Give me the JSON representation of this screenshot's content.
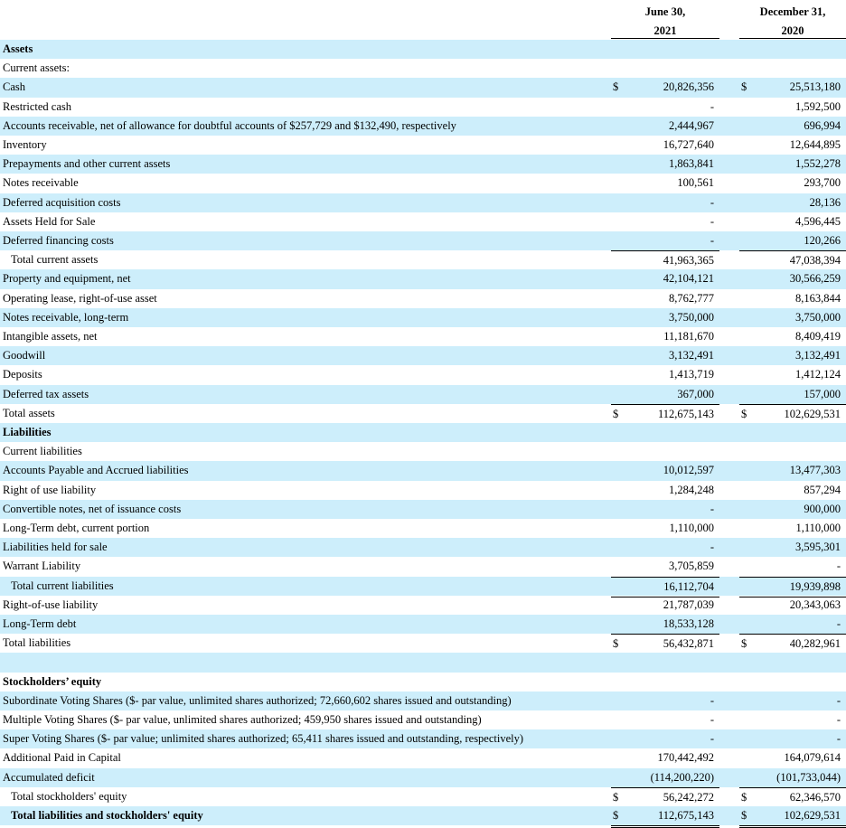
{
  "header": {
    "col1_line1": "June 30,",
    "col1_line2": "2021",
    "col2_line1": "December 31,",
    "col2_line2": "2020"
  },
  "rows": [
    {
      "label": "Assets",
      "bold": true
    },
    {
      "label": "Current assets:"
    },
    {
      "label": "Cash",
      "cur1": "$",
      "v1": "20,826,356",
      "cur2": "$",
      "v2": "25,513,180"
    },
    {
      "label": "Restricted cash",
      "v1": "-",
      "v2": "1,592,500"
    },
    {
      "label": "Accounts receivable, net of allowance for doubtful accounts of $257,729 and $132,490, respectively",
      "v1": "2,444,967",
      "v2": "696,994"
    },
    {
      "label": "Inventory",
      "v1": "16,727,640",
      "v2": "12,644,895"
    },
    {
      "label": "Prepayments and other current assets",
      "v1": "1,863,841",
      "v2": "1,552,278"
    },
    {
      "label": "Notes receivable",
      "v1": "100,561",
      "v2": "293,700"
    },
    {
      "label": "Deferred acquisition costs",
      "v1": "-",
      "v2": "28,136"
    },
    {
      "label": "Assets Held for Sale",
      "v1": "-",
      "v2": "4,596,445"
    },
    {
      "label": "Deferred financing costs",
      "v1": "-",
      "v2": "120,266"
    },
    {
      "label": "Total current assets",
      "indent": true,
      "v1": "41,963,365",
      "v2": "47,038,394",
      "rule": "top-bottom"
    },
    {
      "label": "Property and equipment, net",
      "v1": "42,104,121",
      "v2": "30,566,259"
    },
    {
      "label": "Operating lease, right-of-use asset",
      "v1": "8,762,777",
      "v2": "8,163,844"
    },
    {
      "label": "Notes receivable, long-term",
      "v1": "3,750,000",
      "v2": "3,750,000"
    },
    {
      "label": "Intangible assets, net",
      "v1": "11,181,670",
      "v2": "8,409,419"
    },
    {
      "label": "Goodwill",
      "v1": "3,132,491",
      "v2": "3,132,491"
    },
    {
      "label": "Deposits",
      "v1": "1,413,719",
      "v2": "1,412,124"
    },
    {
      "label": "Deferred tax assets",
      "v1": "367,000",
      "v2": "157,000"
    },
    {
      "label": "Total assets",
      "cur1": "$",
      "v1": "112,675,143",
      "cur2": "$",
      "v2": "102,629,531",
      "rule": "top-double"
    },
    {
      "label": "Liabilities",
      "bold": true
    },
    {
      "label": "Current liabilities"
    },
    {
      "label": "Accounts Payable and Accrued liabilities",
      "v1": "10,012,597",
      "v2": "13,477,303"
    },
    {
      "label": "Right of use liability",
      "v1": "1,284,248",
      "v2": "857,294"
    },
    {
      "label": "Convertible notes, net of issuance costs",
      "v1": "-",
      "v2": "900,000"
    },
    {
      "label": "Long-Term debt, current portion",
      "v1": "1,110,000",
      "v2": "1,110,000"
    },
    {
      "label": "Liabilities held for sale",
      "v1": "-",
      "v2": "3,595,301"
    },
    {
      "label": "Warrant Liability",
      "v1": "3,705,859",
      "v2": "-"
    },
    {
      "label": "Total current liabilities",
      "indent": true,
      "v1": "16,112,704",
      "v2": "19,939,898",
      "rule": "top-bottom"
    },
    {
      "label": "Right-of-use liability",
      "v1": "21,787,039",
      "v2": "20,343,063"
    },
    {
      "label": "Long-Term debt",
      "v1": "18,533,128",
      "v2": "-"
    },
    {
      "label": "Total liabilities",
      "cur1": "$",
      "v1": "56,432,871",
      "cur2": "$",
      "v2": "40,282,961",
      "rule": "top-double"
    },
    {
      "label": ""
    },
    {
      "label": "Stockholders’ equity",
      "bold": true
    },
    {
      "label": "Subordinate Voting Shares ($- par value, unlimited shares authorized; 72,660,602 shares issued and outstanding)",
      "v1": "-",
      "v2": "-"
    },
    {
      "label": "Multiple Voting Shares ($- par value, unlimited shares authorized; 459,950 shares issued and outstanding)",
      "v1": "-",
      "v2": "-"
    },
    {
      "label": "Super Voting Shares ($- par value; unlimited shares authorized; 65,411 shares issued and outstanding, respectively)",
      "v1": "-",
      "v2": "-"
    },
    {
      "label": "Additional Paid in Capital",
      "v1": "170,442,492",
      "v2": "164,079,614"
    },
    {
      "label": "Accumulated deficit",
      "v1": "(114,200,220)",
      "v2": "(101,733,044)"
    },
    {
      "label": "Total stockholders' equity",
      "indent": true,
      "cur1": "$",
      "v1": "56,242,272",
      "cur2": "$",
      "v2": "62,346,570",
      "rule": "top-double"
    },
    {
      "label": "Total liabilities and stockholders' equity",
      "indent": true,
      "bold": true,
      "cur1": "$",
      "v1": "112,675,143",
      "cur2": "$",
      "v2": "102,629,531",
      "rule": "double"
    }
  ]
}
